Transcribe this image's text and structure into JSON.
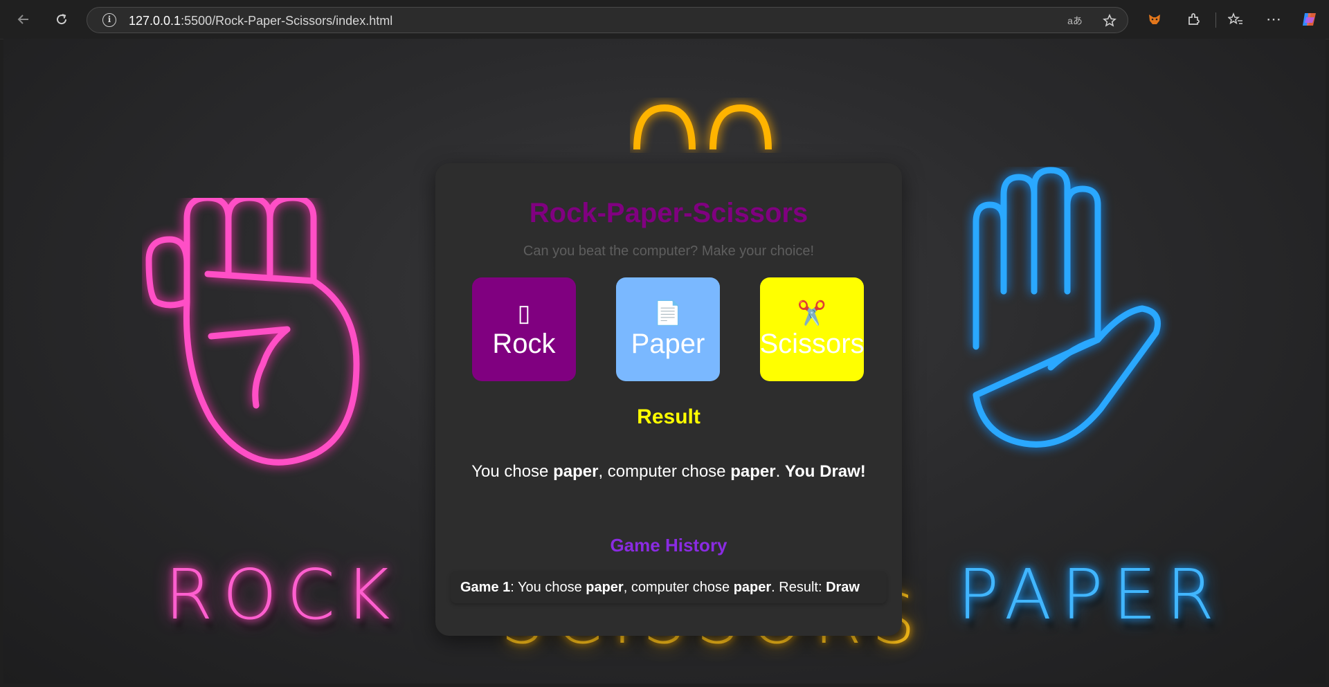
{
  "browser": {
    "url_host": "127.0.0.1",
    "url_rest": ":5500/Rock-Paper-Scissors/index.html",
    "translate_label": "aあ"
  },
  "background": {
    "rock_label": "ROCK",
    "paper_label": "PAPER",
    "scissors_label": "SCISSORS"
  },
  "game": {
    "title": "Rock-Paper-Scissors",
    "subtitle": "Can you beat the computer? Make your choice!",
    "choices": [
      {
        "emoji": "▯",
        "label": "Rock"
      },
      {
        "emoji": "📄",
        "label": "Paper"
      },
      {
        "emoji": "✂️",
        "label": "Scissors"
      }
    ],
    "result_heading": "Result",
    "result": {
      "p1": "You chose ",
      "user_choice": "paper",
      "p2": ", computer chose ",
      "computer_choice": "paper",
      "p3": ". ",
      "outcome": "You Draw!"
    },
    "history_heading": "Game History",
    "history": [
      {
        "game_label": "Game 1",
        "t1": ": You chose ",
        "user_choice": "paper",
        "t2": ", computer chose ",
        "computer_choice": "paper",
        "t3": ". Result: ",
        "result": "Draw"
      }
    ]
  },
  "colors": {
    "title": "#800080",
    "rock_bg": "#800080",
    "paper_bg": "#7ab8ff",
    "scissors_bg": "#ffff00",
    "result_heading": "#ffff00",
    "history_heading": "#8a2be2"
  }
}
